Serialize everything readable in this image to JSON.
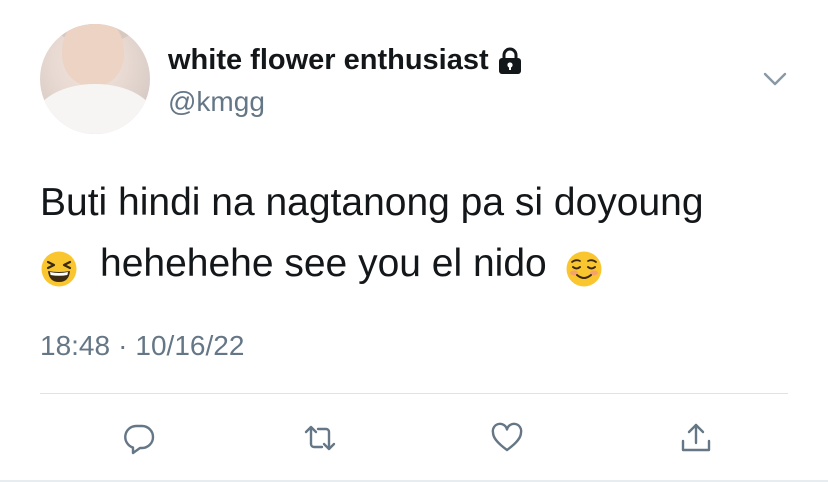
{
  "tweet": {
    "display_name": "white flower enthusiast",
    "handle": "@kmgg",
    "protected_icon": "lock-icon",
    "menu_icon": "chevron-down-icon",
    "text_line1": "Buti hindi na nagtanong pa si doyoung",
    "text_line2": "hehehehe see you el nido",
    "emoji_1": "grinning-squinting-face-emoji",
    "emoji_2": "smiling-face-emoji",
    "time": "18:48",
    "separator": "·",
    "date": "10/16/22"
  },
  "actions": {
    "reply_icon": "reply-icon",
    "retweet_icon": "retweet-icon",
    "like_icon": "heart-icon",
    "share_icon": "share-icon"
  },
  "colors": {
    "text": "#14171a",
    "secondary": "#657786",
    "divider": "#dfe3e6",
    "icon": "#657786",
    "emoji_yellow": "#f9c630"
  }
}
